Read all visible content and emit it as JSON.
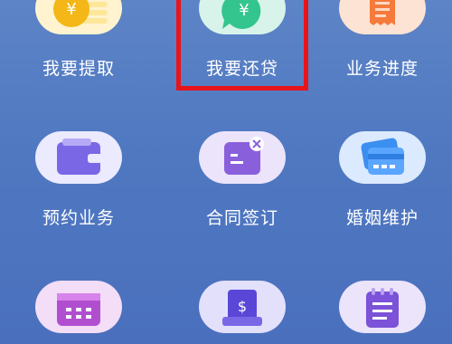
{
  "grid": {
    "row1": [
      {
        "label": "我要提取",
        "icon": "yen-coin-stack-icon",
        "bg": "#fff4cf"
      },
      {
        "label": "我要还贷",
        "icon": "yen-speech-bubble-icon",
        "bg": "#d8f4ea"
      },
      {
        "label": "业务进度",
        "icon": "receipt-icon",
        "bg": "#fde3d3"
      }
    ],
    "row2": [
      {
        "label": "预约业务",
        "icon": "wallet-icon",
        "bg": "#ebeaff"
      },
      {
        "label": "合同签订",
        "icon": "contract-sign-icon",
        "bg": "#ece4fb"
      },
      {
        "label": "婚姻维护",
        "icon": "bank-card-icon",
        "bg": "#dceaff"
      }
    ],
    "row3": [
      {
        "icon": "calendar-icon",
        "bg": "#f3ddf7"
      },
      {
        "icon": "bill-print-icon",
        "bg": "#e3e0fb"
      },
      {
        "icon": "notepad-icon",
        "bg": "#ebe4fb"
      }
    ]
  },
  "highlight_color": "#e8141c"
}
